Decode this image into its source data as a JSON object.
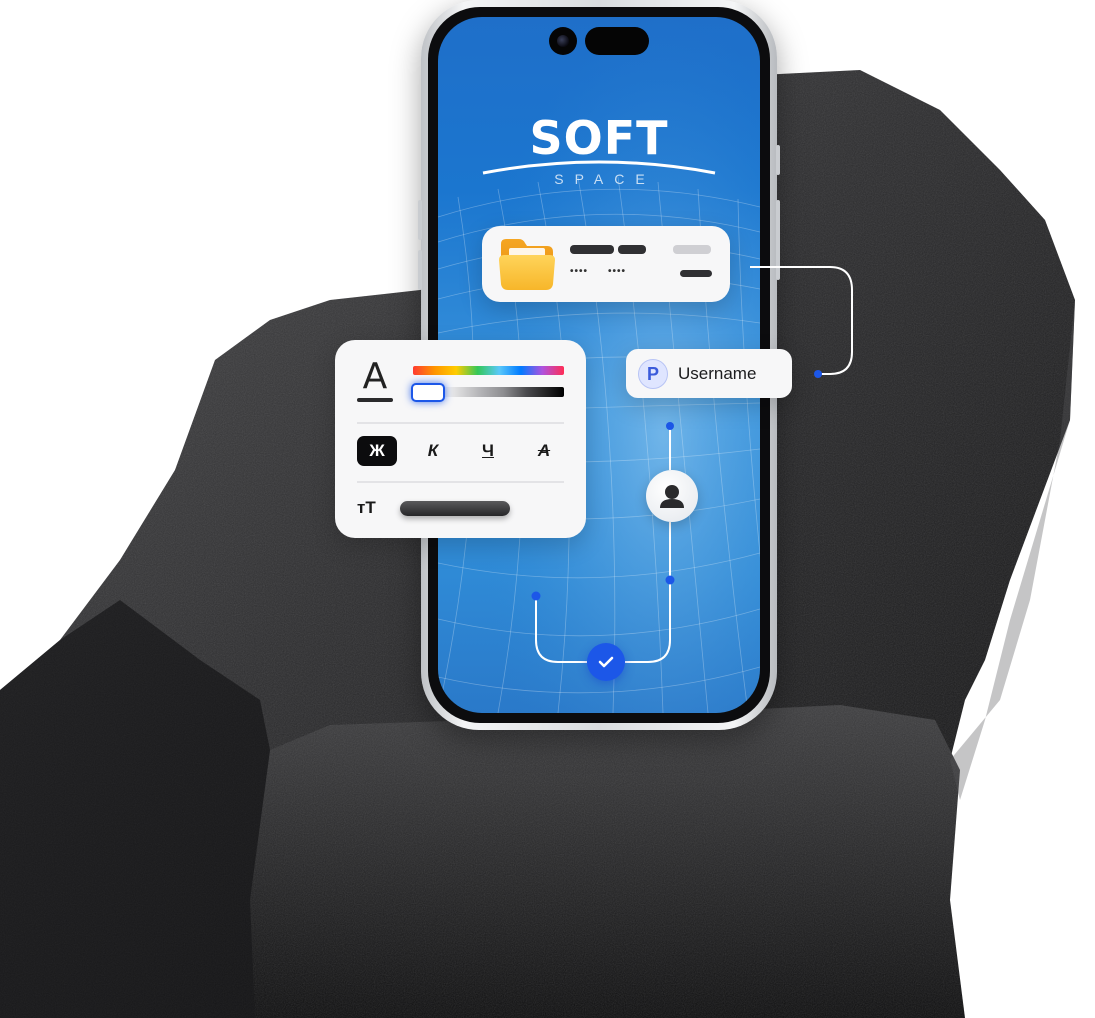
{
  "app": {
    "logo_title": "SOFT",
    "logo_subtitle": "SPACE"
  },
  "user_chip": {
    "icon_letter": "P",
    "label": "Username"
  },
  "file_card": {
    "icon": "folder-icon",
    "dots_a": "••••",
    "dots_b": "••••"
  },
  "text_card": {
    "icon": "text-color-icon",
    "glyph": "A",
    "buttons": {
      "bold": "Ж",
      "italic": "К",
      "underline": "Ч",
      "strike": "А"
    },
    "size_icon": "text-size-icon",
    "size_glyph": "тТ"
  },
  "flow": {
    "avatar_icon": "user-avatar-icon",
    "check_icon": "checkmark-icon"
  },
  "colors": {
    "accent": "#1c57e8",
    "screen_top": "#1f6fc9",
    "screen_mid": "#3a94dc",
    "card_bg": "#f7f7f8"
  }
}
